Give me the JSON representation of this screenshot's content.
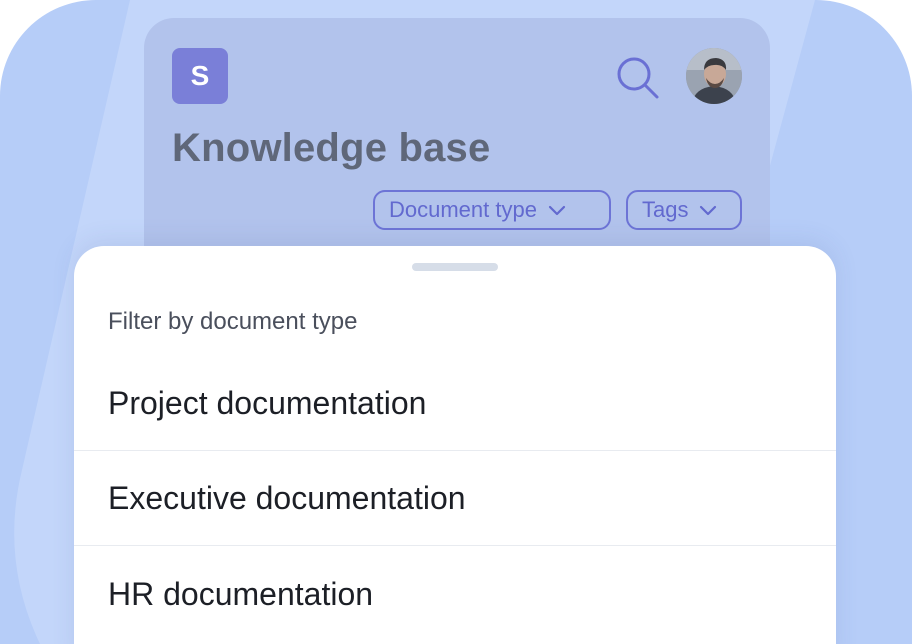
{
  "colors": {
    "background": "#b6cdf8",
    "app_panel": "#b2c3ec",
    "logo": "#7a7fd8",
    "accent": "#6269cf",
    "title": "#5f6779",
    "sheet": "#ffffff"
  },
  "header": {
    "logo_letter": "S",
    "title": "Knowledge base",
    "search_icon": "search-icon",
    "avatar_icon": "user-avatar"
  },
  "filters": {
    "document_type_label": "Document type",
    "tags_label": "Tags",
    "chevron_icon": "chevron-down-icon"
  },
  "sheet": {
    "heading": "Filter by document type",
    "options": [
      {
        "label": "Project documentation"
      },
      {
        "label": "Executive documentation"
      },
      {
        "label": "HR documentation"
      }
    ]
  }
}
